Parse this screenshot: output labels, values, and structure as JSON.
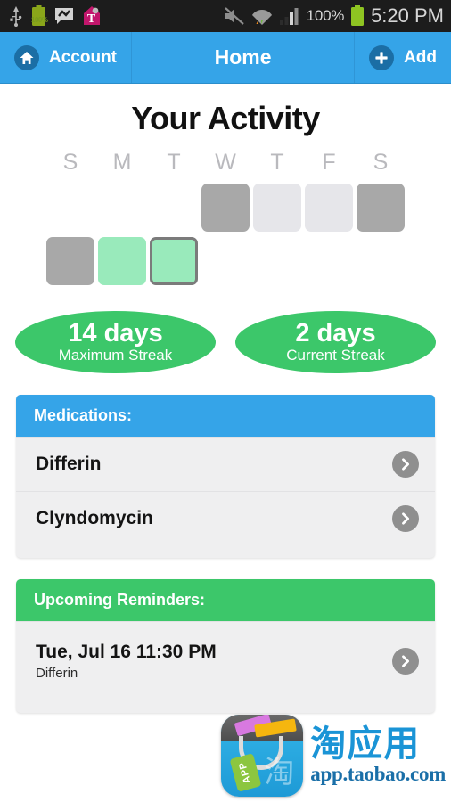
{
  "statusbar": {
    "icons": [
      "usb-icon",
      "battery-icon",
      "messenger-icon",
      "tmobile-icon",
      "mute-icon",
      "wifi-icon",
      "signal-icon"
    ],
    "battery_badge": "100%",
    "battery_percent": "100%",
    "time": "5:20 PM"
  },
  "actionbar": {
    "account_label": "Account",
    "account_icon": "home-icon",
    "title": "Home",
    "add_label": "Add",
    "add_icon": "plus-icon",
    "background_color": "#35a4e8",
    "icon_circle_color": "#1b6ea5"
  },
  "activity": {
    "title": "Your Activity",
    "day_labels": [
      "S",
      "M",
      "T",
      "W",
      "T",
      "F",
      "S"
    ],
    "legend_colors": {
      "missed": "#a8a8a8",
      "none": "#e6e6ea",
      "done": "#99eabb",
      "today_border": "#7b7b7b"
    },
    "rows": [
      [
        "empty",
        "empty",
        "empty",
        "missed",
        "none",
        "none",
        "missed"
      ],
      [
        "missed",
        "done",
        "today",
        "empty",
        "empty",
        "empty",
        "empty"
      ]
    ]
  },
  "streaks": [
    {
      "value": "14 days",
      "label": "Maximum Streak"
    },
    {
      "value": "2 days",
      "label": "Current Streak"
    }
  ],
  "medications": {
    "header": "Medications:",
    "header_color": "#35a4e8",
    "items": [
      {
        "name": "Differin",
        "chevron": "chevron-right-icon"
      },
      {
        "name": "Clyndomycin",
        "chevron": "chevron-right-icon"
      }
    ]
  },
  "reminders": {
    "header": "Upcoming Reminders:",
    "header_color": "#3cc76a",
    "items": [
      {
        "when": "Tue, Jul 16 11:30 PM",
        "medication": "Differin",
        "chevron": "chevron-right-icon"
      }
    ]
  },
  "watermark": {
    "tag_text": "APP",
    "bag_char": "淘",
    "brand_cn": "淘应用",
    "url": "app.taobao.com"
  }
}
